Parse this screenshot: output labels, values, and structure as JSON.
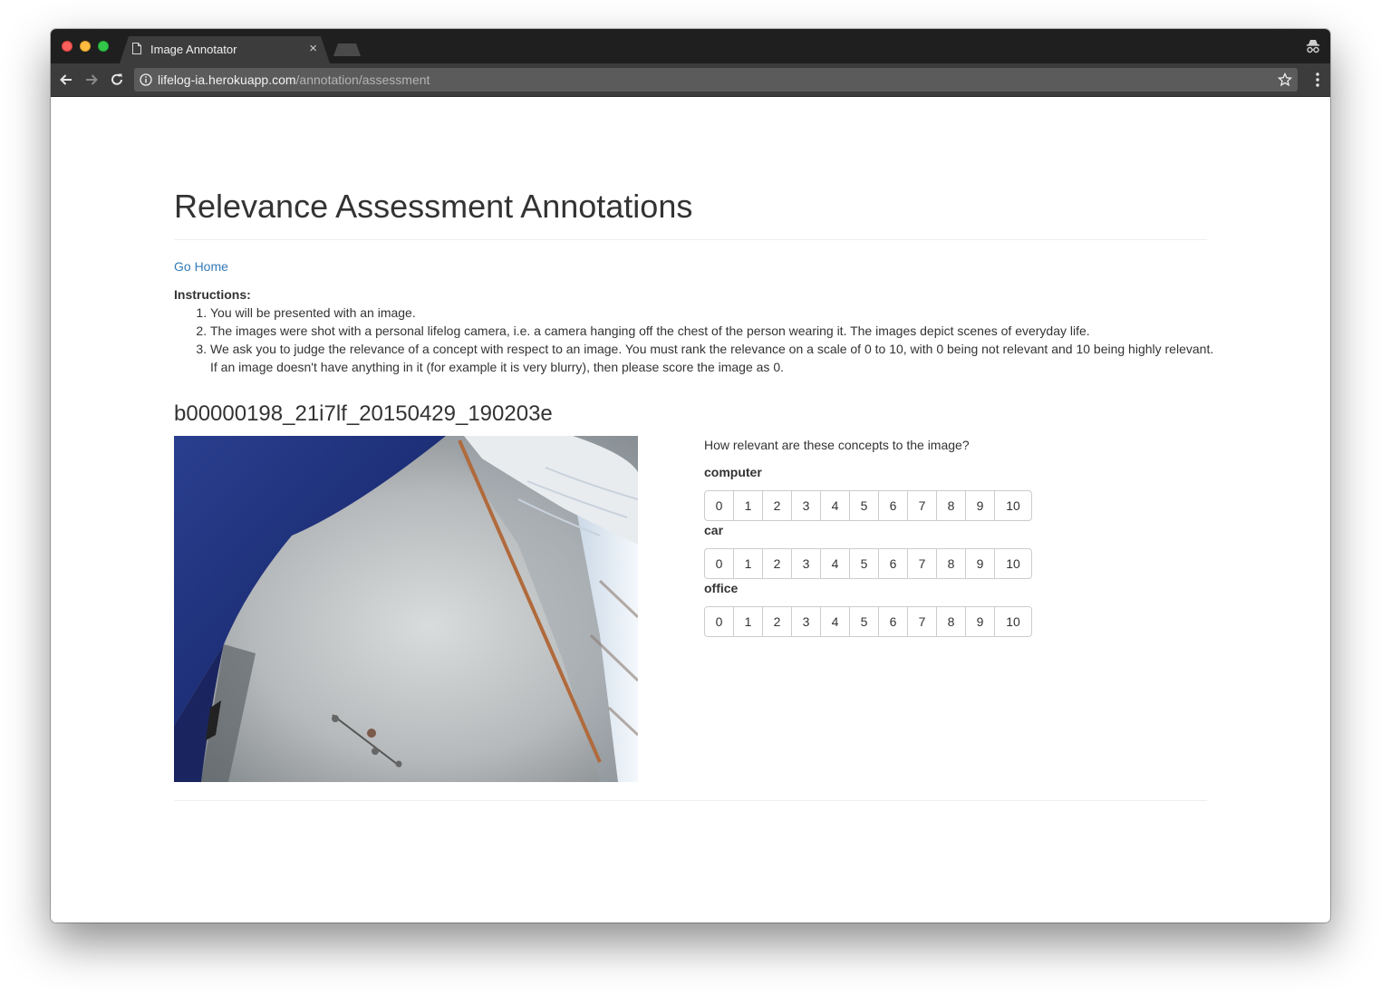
{
  "browser": {
    "tab_title": "Image Annotator",
    "tab_close": "×",
    "url_host": "lifelog-ia.herokuapp.com",
    "url_path": "/annotation/assessment"
  },
  "page": {
    "title": "Relevance Assessment Annotations",
    "go_home": "Go Home",
    "instructions_label": "Instructions:",
    "instructions": [
      "You will be presented with an image.",
      "The images were shot with a personal lifelog camera, i.e. a camera hanging off the chest of the person wearing it. The images depict scenes of everyday life.",
      "We ask you to judge the relevance of a concept with respect to an image. You must rank the relevance on a scale of 0 to 10, with 0 being not relevant and 10 being highly relevant. If an image doesn't have anything in it (for example it is very blurry), then please score the image as 0."
    ],
    "image_id": "b00000198_21i7lf_20150429_190203e",
    "question": "How relevant are these concepts to the image?",
    "concepts": [
      {
        "name": "computer",
        "scores": [
          "0",
          "1",
          "2",
          "3",
          "4",
          "5",
          "6",
          "7",
          "8",
          "9",
          "10"
        ]
      },
      {
        "name": "car",
        "scores": [
          "0",
          "1",
          "2",
          "3",
          "4",
          "5",
          "6",
          "7",
          "8",
          "9",
          "10"
        ]
      },
      {
        "name": "office",
        "scores": [
          "0",
          "1",
          "2",
          "3",
          "4",
          "5",
          "6",
          "7",
          "8",
          "9",
          "10"
        ]
      }
    ]
  },
  "colors": {
    "link": "#337ab7",
    "text": "#333333",
    "chrome_dark": "#1f1f1f",
    "chrome_toolbar": "#3c3c3c"
  }
}
